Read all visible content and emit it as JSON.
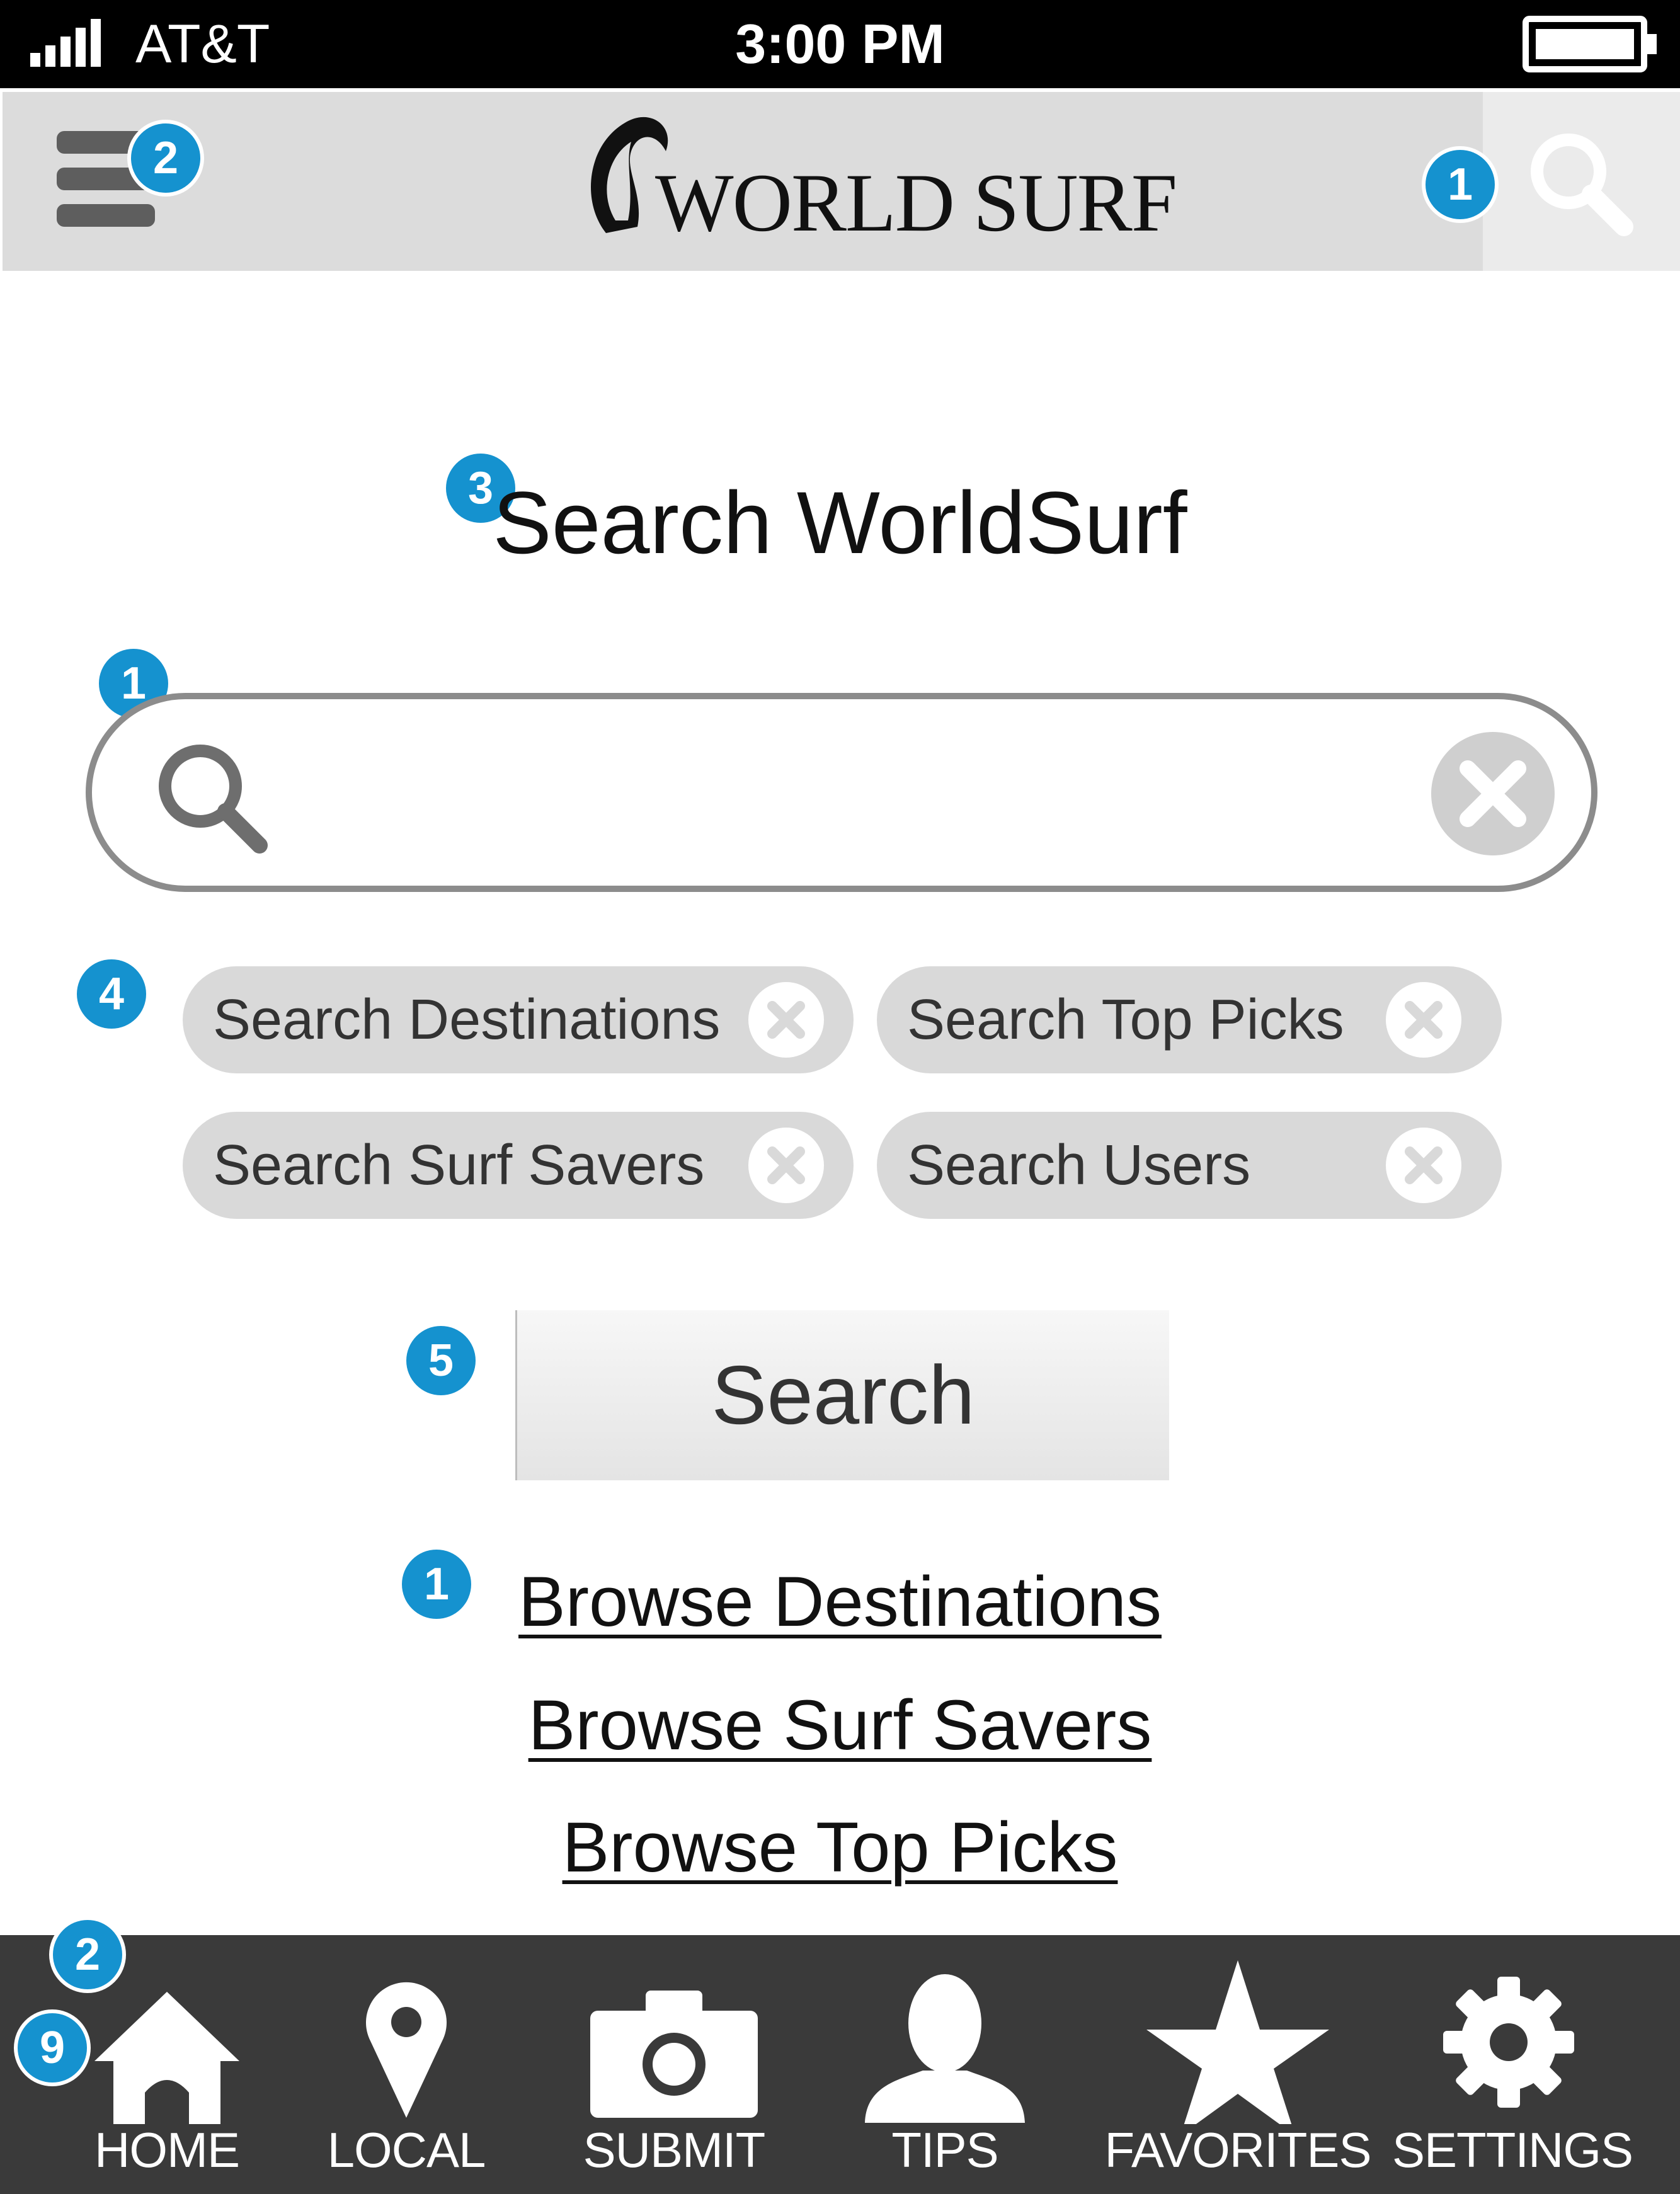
{
  "status_bar": {
    "carrier": "AT&T",
    "time": "3:00 PM"
  },
  "header": {
    "logo_text": "WORLD SURF",
    "menu_badge": "2",
    "search_badge": "1"
  },
  "title": {
    "text": "Search WorldSurf",
    "badge": "3"
  },
  "search": {
    "badge": "1",
    "value": "",
    "placeholder": ""
  },
  "filters": {
    "badge": "4",
    "chips": [
      {
        "label": "Search Destinations"
      },
      {
        "label": "Search Top Picks"
      },
      {
        "label": "Search Surf Savers"
      },
      {
        "label": "Search Users"
      }
    ]
  },
  "search_button": {
    "label": "Search",
    "badge": "5"
  },
  "browse": {
    "badge": "1",
    "links": [
      {
        "label": "Browse Destinations"
      },
      {
        "label": "Browse Surf Savers"
      },
      {
        "label": "Browse Top Picks"
      }
    ]
  },
  "bottom_nav": {
    "badge_top": "2",
    "badge_home": "9",
    "items": [
      {
        "label": "HOME",
        "icon": "home-icon"
      },
      {
        "label": "LOCAL",
        "icon": "map-pin-icon"
      },
      {
        "label": "SUBMIT",
        "icon": "camera-icon"
      },
      {
        "label": "TIPS",
        "icon": "person-icon"
      },
      {
        "label": "FAVORITES",
        "icon": "star-icon"
      },
      {
        "label": "SETTINGS",
        "icon": "gear-icon"
      }
    ]
  },
  "colors": {
    "badge": "#1592cf",
    "header_bg": "#dcdcdc",
    "nav_bg": "#3a3a3a",
    "chip_bg": "#d9d9d9"
  }
}
